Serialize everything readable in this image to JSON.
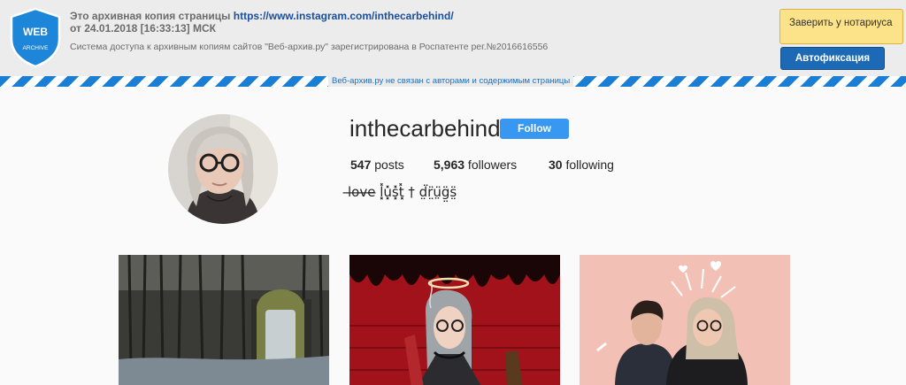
{
  "archive": {
    "title_prefix": "Это архивная копия страницы",
    "url": "https://www.instagram.com/inthecarbehind/",
    "date": "от 24.01.2018 [16:33:13] МСК",
    "notice": "Система доступа к архивным копиям сайтов \"Веб-архив.ру\" зарегистрирована в Роспатенте рег.№2016616556",
    "disclaimer": "Веб-архив.ру не связан с авторами и содержимым страницы",
    "logo_line1": "WEB",
    "logo_line2": "ARCHIVE",
    "btn_notary": "Заверить у нотариуса",
    "btn_auto": "Автофиксация",
    "colors": {
      "stripe_blue": "#1a7ed4",
      "notary_yellow": "#fce38a",
      "auto_blue": "#1c69b5"
    }
  },
  "profile": {
    "username": "inthecarbehind",
    "follow_label": "Follow",
    "posts_count": "547",
    "posts_label": " posts",
    "followers_count": "5,963",
    "followers_label": " followers",
    "following_count": "30",
    "following_label": " following",
    "bio": "l̶o̶v̶e̶ l͓̽u͓̽s͓̽t͓̽ † d̤̈r̤̈ṳ̈g̤̈s̤̈",
    "colors": {
      "follow_blue": "#3897f0"
    }
  },
  "posts": [
    {
      "subject": "forest-photo"
    },
    {
      "subject": "illustration-red"
    },
    {
      "subject": "couple-photo"
    }
  ]
}
